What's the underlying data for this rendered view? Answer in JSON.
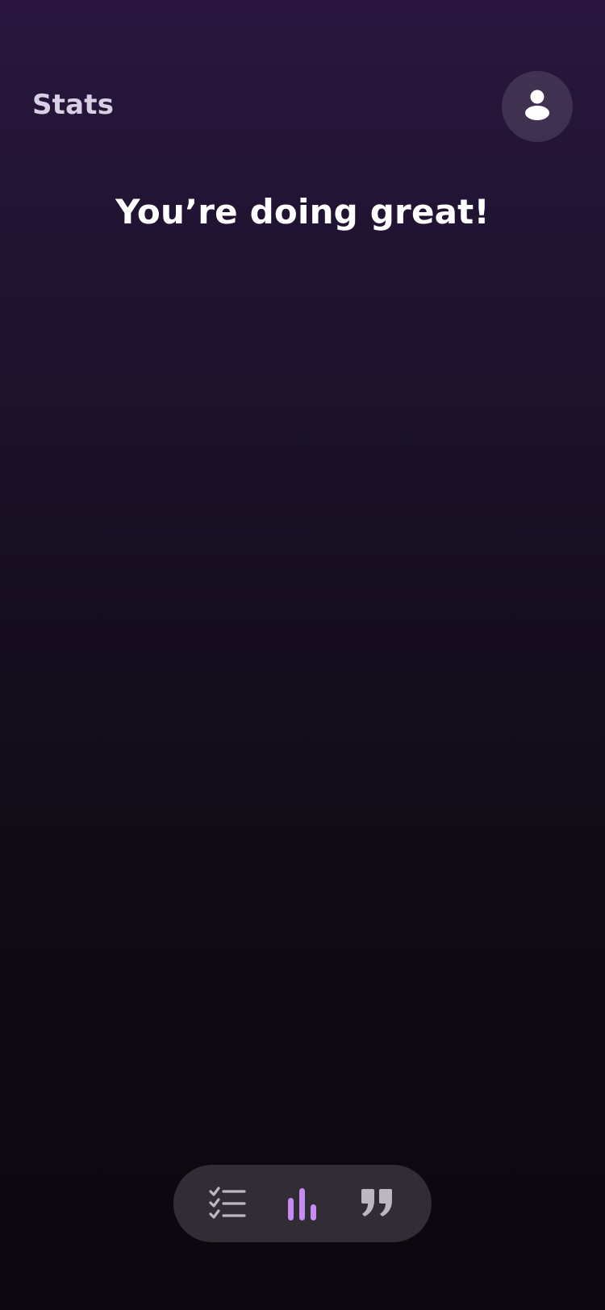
{
  "header": {
    "title": "Stats",
    "profile_icon": "person-icon"
  },
  "main": {
    "headline": "You’re doing great!"
  },
  "tab_bar": {
    "active_index": 1,
    "active_color": "#c58cf3",
    "inactive_color": "#bdb7c2",
    "tabs": [
      {
        "icon": "checklist-icon"
      },
      {
        "icon": "bar-chart-icon"
      },
      {
        "icon": "quote-icon"
      }
    ]
  },
  "colors": {
    "background_top": "#2a163f",
    "background_bottom": "#0c080f",
    "tab_bar_bg": "#312d34"
  }
}
